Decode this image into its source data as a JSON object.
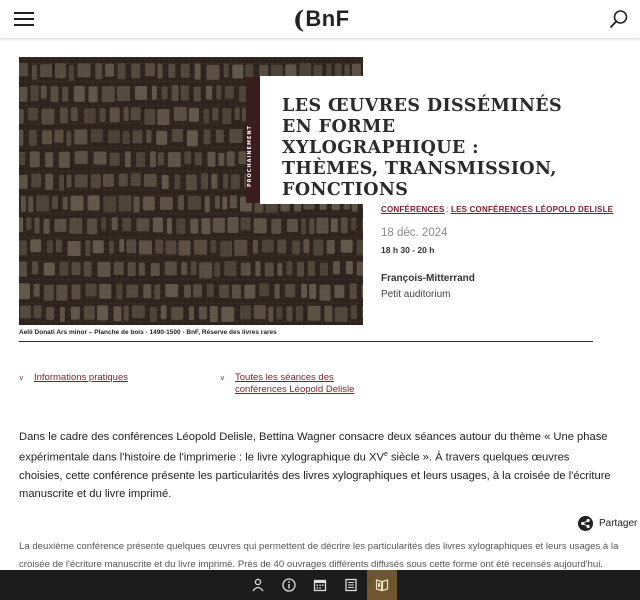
{
  "header": {
    "logo_paren": "(",
    "logo_text": "BnF",
    "menu_icon": "hamburger-icon",
    "search_icon": "search-icon"
  },
  "hero": {
    "side_tag": "PROCHAINEMENT",
    "title": "Les Œuvres disséminés en forme xylographique : thèmes, transmission, fonctions",
    "caption": "Aelii Donati Ars minor – Planche de bois - 1490-1500 - BnF, Réserve des livres rares"
  },
  "meta": {
    "category1": "Conférences",
    "separator": ":",
    "category2": "Les conférences Léopold Delisle",
    "date": "18 déc. 2024",
    "time": "18 h 30 - 20 h",
    "place": "François-Mitterrand",
    "room": "Petit auditorium"
  },
  "links": {
    "practical": "Informations pratiques",
    "all_sessions": "Toutes les séances des conférences Léopold Delisle"
  },
  "intro": {
    "before_sup": "Dans le cadre des conférences Léopold Delisle, Bettina Wagner consacre deux séances autour du thème « Une phase expérimentale dans l'histoire de l'imprimerie : le livre xylographique du XV",
    "sup": "e",
    "after_sup": " siècle ». À travers quelques œuvres choisies, cette conférence présente les particularités des livres xylographiques et leurs usages, à la croisée de l'écriture manuscrite et du livre imprimé."
  },
  "share": {
    "label": "Partager",
    "icon": "share-icon"
  },
  "body2": "La deuxième conférence présente quelques œuvres qui permettent de décrire les particularités des livres xylographiques et leurs usages à la croisée de l'écriture manuscrite et du livre imprimé. Près de 40 ouvrages différents diffusés sous cette forme ont été recensés aujourd'hui. Parmi",
  "bottom_nav": {
    "items": [
      "visitor-icon",
      "info-icon",
      "calendar-icon",
      "catalogue-icon",
      "gallica-icon"
    ],
    "active_index": 4
  },
  "colors": {
    "accent": "#7a1f2b",
    "tag_bg": "#3b1c1f",
    "bottom_bar": "#1c1c1c",
    "bottom_active": "#6e5730"
  }
}
